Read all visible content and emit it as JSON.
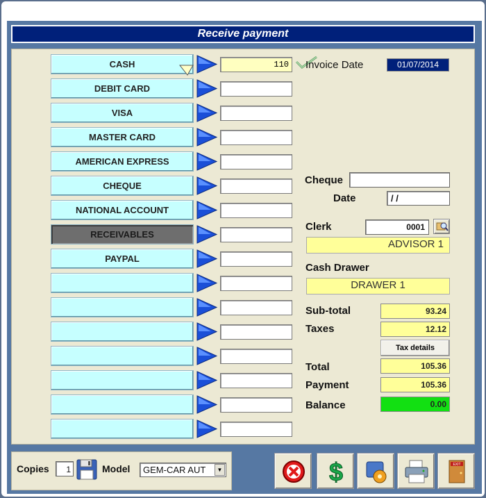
{
  "window": {
    "title": "Receive payment"
  },
  "payment_methods": [
    {
      "label": "CASH",
      "amount": "110"
    },
    {
      "label": "DEBIT CARD",
      "amount": ""
    },
    {
      "label": "VISA",
      "amount": ""
    },
    {
      "label": "MASTER CARD",
      "amount": ""
    },
    {
      "label": "AMERICAN EXPRESS",
      "amount": ""
    },
    {
      "label": "CHEQUE",
      "amount": ""
    },
    {
      "label": "NATIONAL ACCOUNT",
      "amount": ""
    },
    {
      "label": "RECEIVABLES",
      "amount": ""
    },
    {
      "label": "PAYPAL",
      "amount": ""
    },
    {
      "label": "",
      "amount": ""
    },
    {
      "label": "",
      "amount": ""
    },
    {
      "label": "",
      "amount": ""
    },
    {
      "label": "",
      "amount": ""
    },
    {
      "label": "",
      "amount": ""
    },
    {
      "label": "",
      "amount": ""
    },
    {
      "label": "",
      "amount": ""
    }
  ],
  "invoice": {
    "label": "Invoice Date",
    "date": "01/07/2014"
  },
  "cheque": {
    "label": "Cheque",
    "number": "",
    "date_label": "Date",
    "date": " / /"
  },
  "clerk": {
    "label": "Clerk",
    "code": "0001",
    "name": "ADVISOR 1"
  },
  "cash_drawer": {
    "label": "Cash Drawer",
    "name": "DRAWER 1"
  },
  "totals": {
    "subtotal_label": "Sub-total",
    "subtotal": "93.24",
    "taxes_label": "Taxes",
    "taxes": "12.12",
    "tax_details_label": "Tax details",
    "total_label": "Total",
    "total": "105.36",
    "payment_label": "Payment",
    "payment": "105.36",
    "balance_label": "Balance",
    "balance": "0.00"
  },
  "footer": {
    "copies_label": "Copies",
    "copies": "1",
    "model_label": "Model",
    "model": "GEM-CAR AUT"
  },
  "colors": {
    "accent": "#00207a",
    "button": "#c6ffff",
    "highlight": "#ffff99",
    "balance": "#12e012"
  }
}
